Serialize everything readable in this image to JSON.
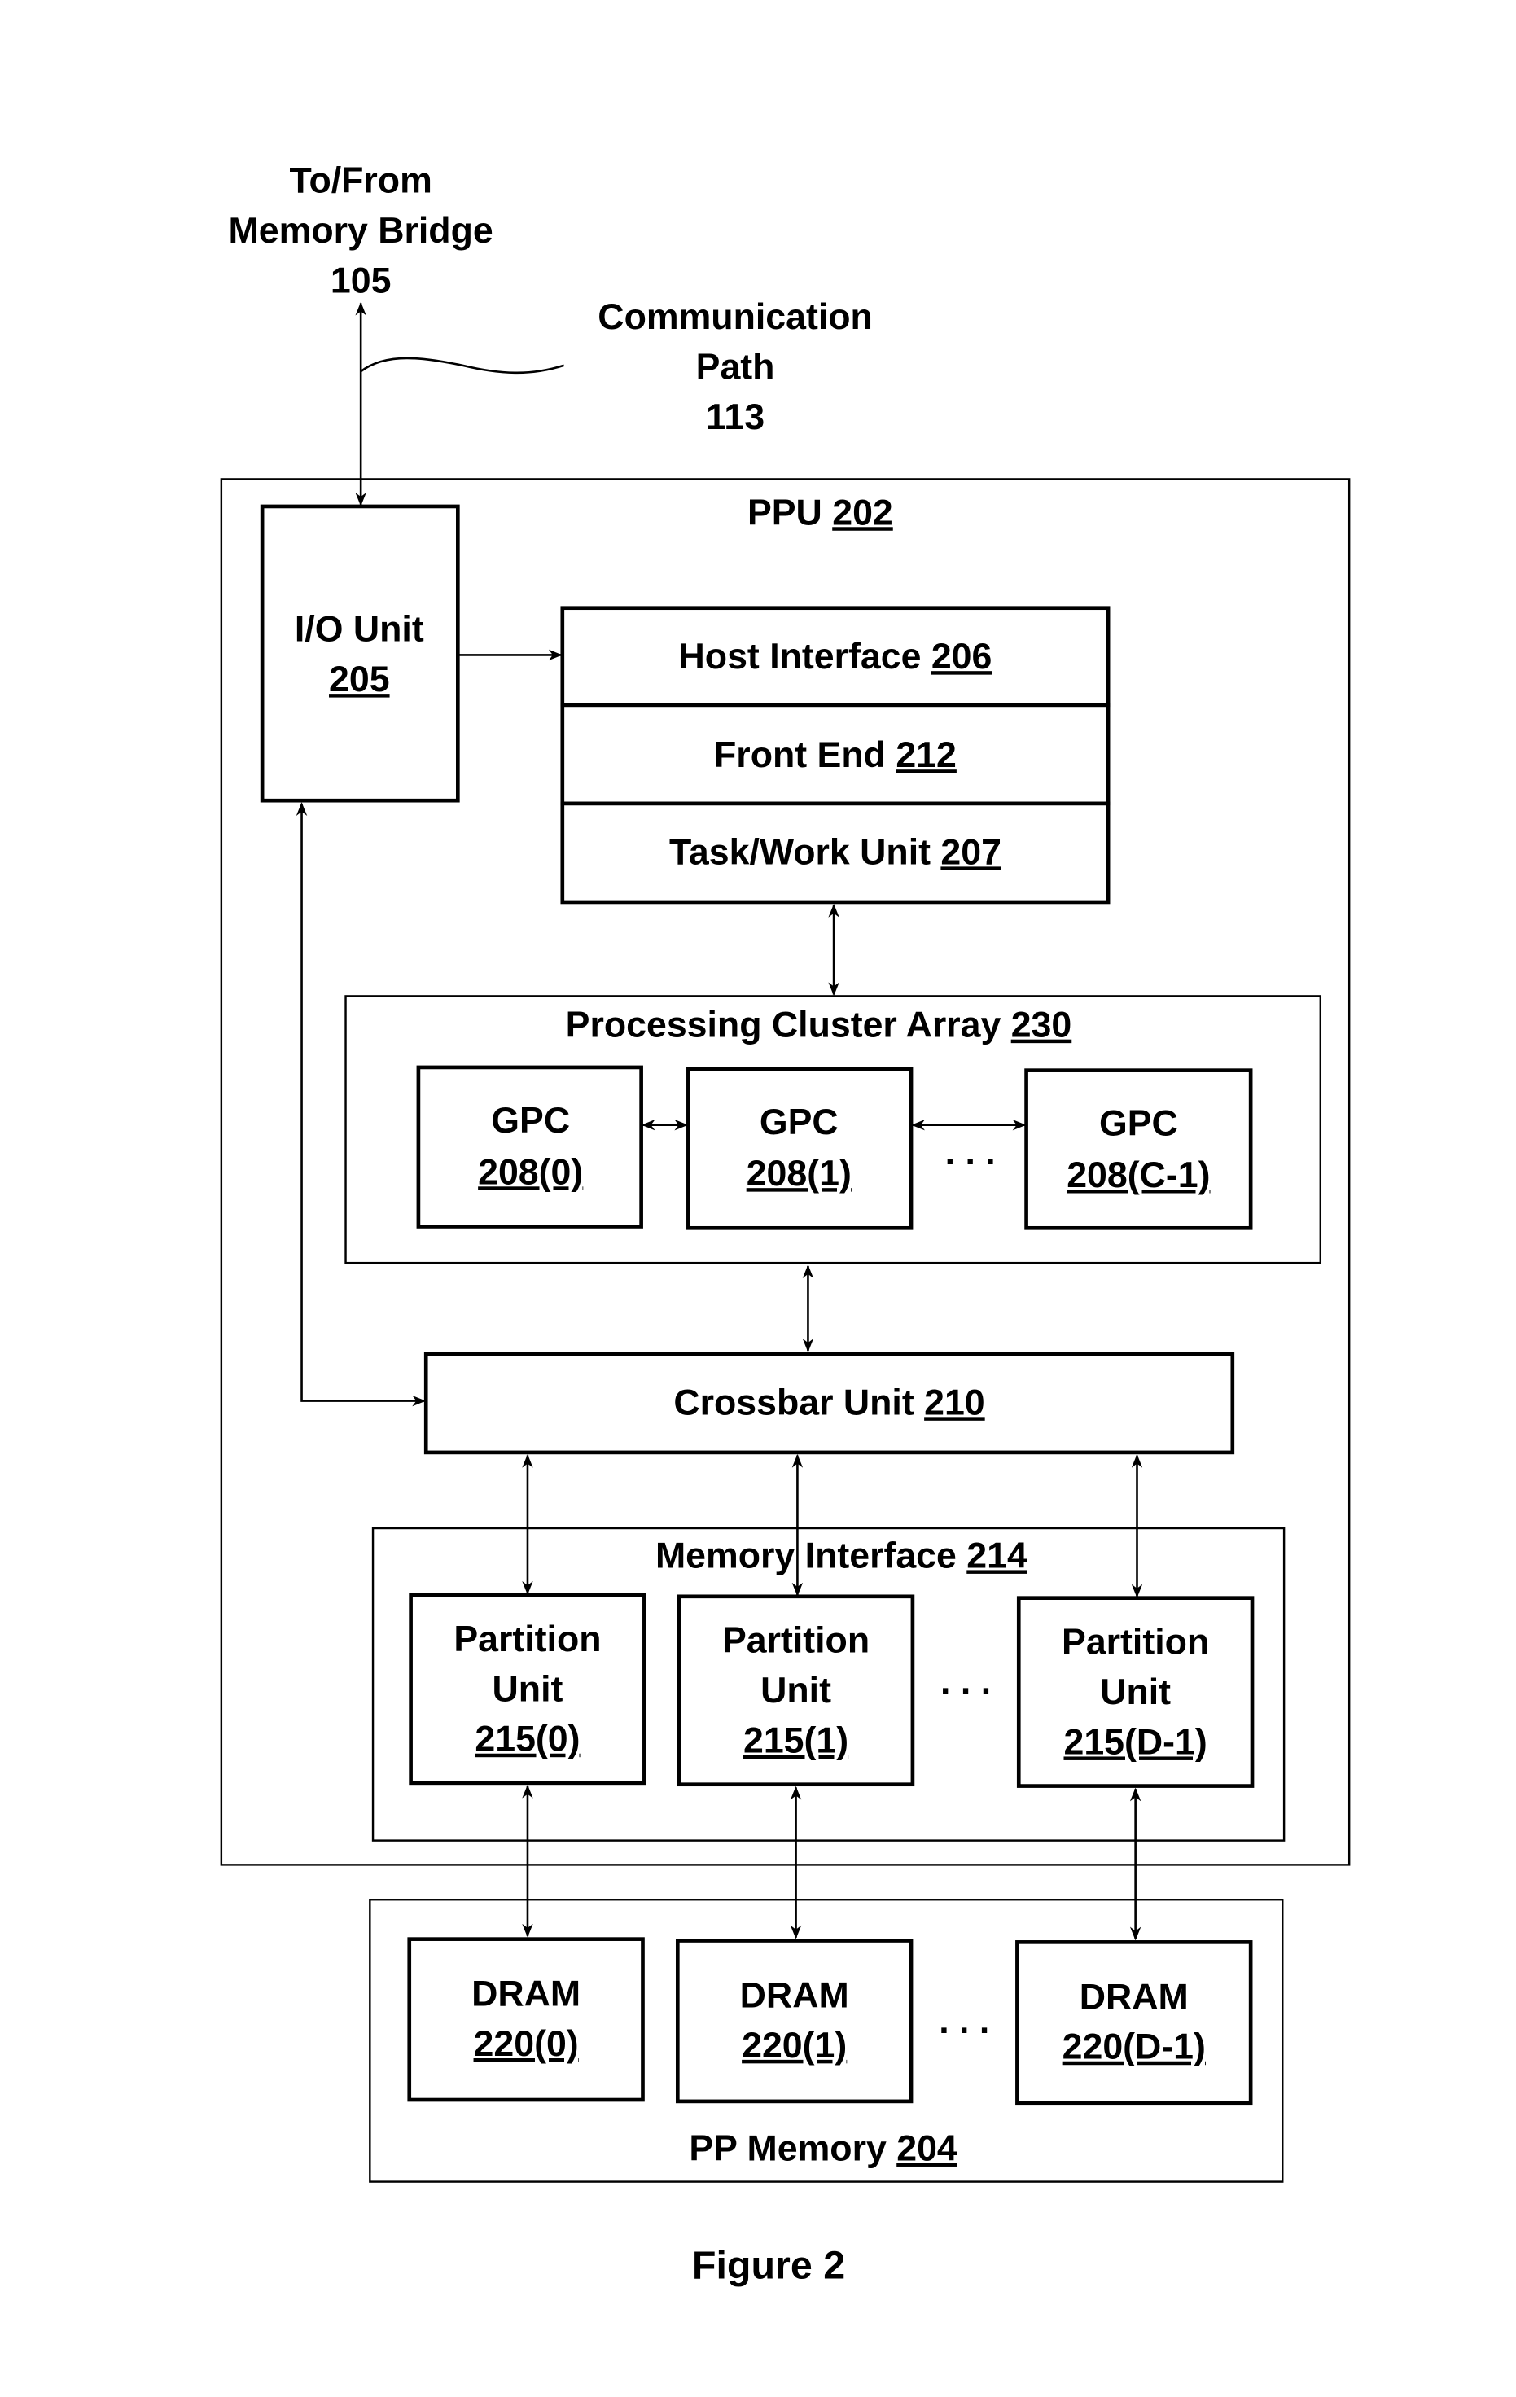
{
  "figure": {
    "caption": "Figure 2",
    "external": {
      "memory_bridge": [
        "To/From",
        "Memory Bridge",
        "105"
      ],
      "comm_path": [
        "Communication",
        "Path",
        "113"
      ]
    },
    "ppu": {
      "name": "PPU ",
      "ref": "202"
    },
    "io_unit": {
      "name": "I/O Unit",
      "ref": "205"
    },
    "host_interface": {
      "name": "Host Interface ",
      "ref": "206"
    },
    "front_end": {
      "name": "Front End ",
      "ref": "212"
    },
    "task_work_unit": {
      "name": "Task/Work Unit ",
      "ref": "207"
    },
    "pca": {
      "name": "Processing Cluster Array ",
      "ref": "230",
      "gpcs": [
        {
          "name": "GPC",
          "ref": "208(0)"
        },
        {
          "name": "GPC",
          "ref": "208(1)"
        },
        {
          "name": "GPC",
          "ref": "208(C-1)"
        }
      ],
      "ellipsis": ". . ."
    },
    "crossbar": {
      "name": "Crossbar Unit ",
      "ref": "210"
    },
    "memory_interface": {
      "name": "Memory Interface ",
      "ref": "214",
      "partitions": [
        {
          "line1": "Partition",
          "line2": "Unit",
          "ref": "215(0)"
        },
        {
          "line1": "Partition",
          "line2": "Unit",
          "ref": "215(1)"
        },
        {
          "line1": "Partition",
          "line2": "Unit",
          "ref": "215(D-1)"
        }
      ],
      "ellipsis": ". . ."
    },
    "pp_memory": {
      "name": "PP Memory ",
      "ref": "204",
      "drams": [
        {
          "name": "DRAM",
          "ref": "220(0)"
        },
        {
          "name": "DRAM",
          "ref": "220(1)"
        },
        {
          "name": "DRAM",
          "ref": "220(D-1)"
        }
      ],
      "ellipsis": ". . ."
    }
  }
}
